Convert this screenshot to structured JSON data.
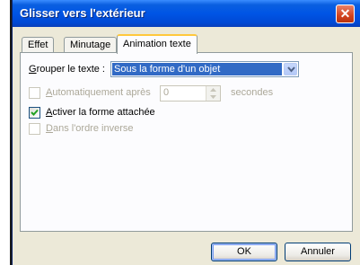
{
  "window": {
    "title": "Glisser vers l'extérieur",
    "close_glyph": "✕"
  },
  "tabs": [
    {
      "label": "Effet",
      "active": false
    },
    {
      "label": "Minutage",
      "active": false
    },
    {
      "label": "Animation texte",
      "active": true
    }
  ],
  "group_text": {
    "label_accel": "G",
    "label_rest": "rouper le texte :",
    "selected_value": "Sous la forme d'un objet"
  },
  "auto_after": {
    "checked": false,
    "enabled": false,
    "label_accel": "A",
    "label_rest": "utomatiquement après",
    "value": "0",
    "unit": "secondes"
  },
  "attached_shape": {
    "checked": true,
    "enabled": true,
    "label_accel": "A",
    "label_rest": "ctiver la forme attachée"
  },
  "reverse_order": {
    "checked": false,
    "enabled": false,
    "label_accel": "D",
    "label_rest": "ans l'ordre inverse"
  },
  "buttons": {
    "ok": "OK",
    "cancel": "Annuler"
  },
  "colors": {
    "titlebar": "#0055e5",
    "selection": "#316ac5",
    "close": "#d2431f"
  }
}
